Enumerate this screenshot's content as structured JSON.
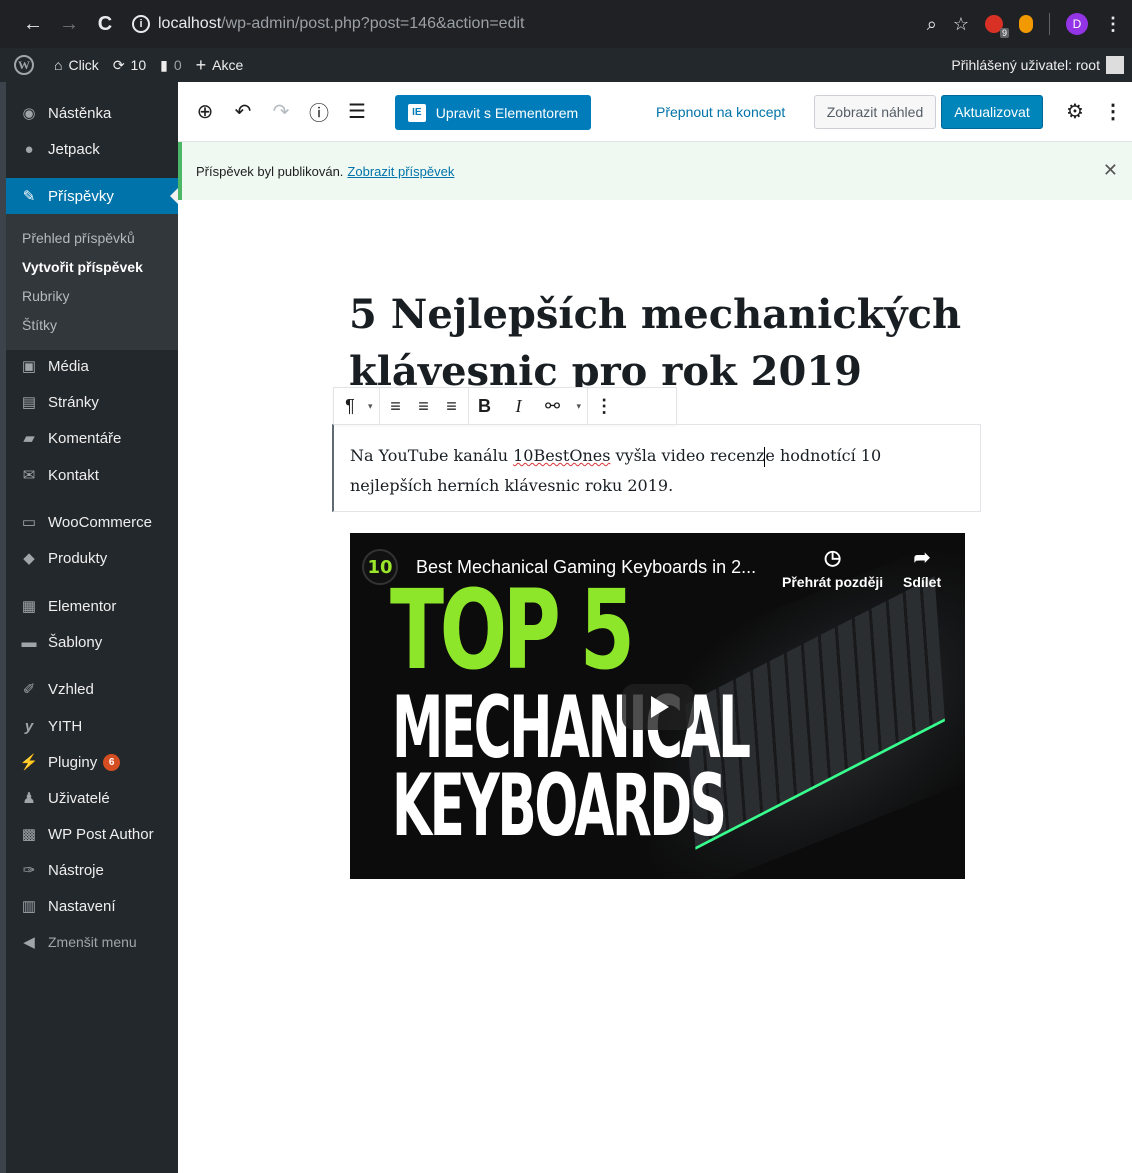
{
  "browser": {
    "url_host": "localhost",
    "url_path": "/wp-admin/post.php?post=146&action=edit",
    "extension_badge": "9",
    "profile_initial": "D"
  },
  "adminbar": {
    "site_name": "Click",
    "updates_count": "10",
    "comments_count": "0",
    "new_label": "Akce",
    "user_greeting": "Přihlášený uživatel: root"
  },
  "sidebar": {
    "items": [
      {
        "label": "Nástěnka",
        "icon": "dashboard-icon"
      },
      {
        "label": "Jetpack",
        "icon": "jetpack-icon"
      },
      {
        "label": "Příspěvky",
        "icon": "pin-icon"
      },
      {
        "label": "Média",
        "icon": "media-icon"
      },
      {
        "label": "Stránky",
        "icon": "pages-icon"
      },
      {
        "label": "Komentáře",
        "icon": "comments-icon"
      },
      {
        "label": "Kontakt",
        "icon": "envelope-icon"
      },
      {
        "label": "WooCommerce",
        "icon": "woo-icon"
      },
      {
        "label": "Produkty",
        "icon": "products-icon"
      },
      {
        "label": "Elementor",
        "icon": "elementor-icon"
      },
      {
        "label": "Šablony",
        "icon": "folder-icon"
      },
      {
        "label": "Vzhled",
        "icon": "brush-icon"
      },
      {
        "label": "YITH",
        "icon": "yith-icon"
      },
      {
        "label": "Pluginy",
        "icon": "plugin-icon",
        "badge": "6"
      },
      {
        "label": "Uživatelé",
        "icon": "users-icon"
      },
      {
        "label": "WP Post Author",
        "icon": "author-icon"
      },
      {
        "label": "Nástroje",
        "icon": "wrench-icon"
      },
      {
        "label": "Nastavení",
        "icon": "settings-icon"
      }
    ],
    "submenu": [
      "Přehled příspěvků",
      "Vytvořit příspěvek",
      "Rubriky",
      "Štítky"
    ],
    "collapse_label": "Zmenšit menu"
  },
  "editor": {
    "elementor_button": "Upravit s Elementorem",
    "switch_draft": "Přepnout na koncept",
    "preview": "Zobrazit náhled",
    "update": "Aktualizovat"
  },
  "notice": {
    "text": "Příspěvek byl publikován.",
    "link": "Zobrazit příspěvek"
  },
  "post": {
    "title": "5 Nejlepších mechanických klávesnic pro rok 2019",
    "paragraph_before": "Na YouTube kanálu ",
    "paragraph_link": "10BestOnes",
    "paragraph_mid": " vyšla video recenz",
    "paragraph_after": "e hodnotící 10 nejlepších herních klávesnic roku 2019."
  },
  "video": {
    "channel_badge": "10",
    "title": "Best Mechanical Gaming Keyboards in 2...",
    "watch_later": "Přehrát později",
    "share": "Sdílet",
    "thumb_line1": "TOP 5",
    "thumb_line2": "MECHANICAL",
    "thumb_line3": "KEYBOARDS"
  },
  "colors": {
    "admin_dark": "#23282d",
    "accent_blue": "#0073aa",
    "notice_green": "#4ab866",
    "badge_orange": "#d54e21"
  }
}
